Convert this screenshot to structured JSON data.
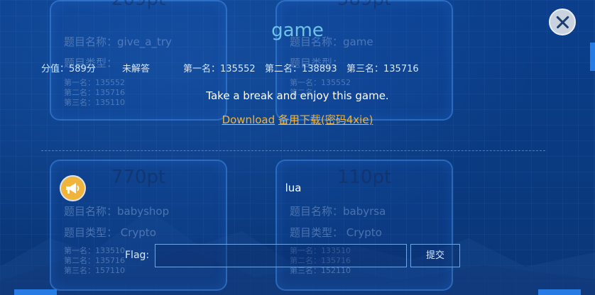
{
  "modal": {
    "title": "game",
    "score": "分值：589分",
    "status": "未解答",
    "rank1": "第一名：135552",
    "rank2": "第二名：138893",
    "rank3": "第三名：135716",
    "description": "Take a break and enjoy this game.",
    "download_label": "Download",
    "backup_label": "备用下载(密码4xie)",
    "hint_text": "lua",
    "flag_label": "Flag:",
    "flag_placeholder": "",
    "submit_label": "提交"
  },
  "background_cards": [
    {
      "points": "209pt",
      "name": "题目名称：give_a_try",
      "type": "题目类型：",
      "r1": "第一名：135552",
      "r2": "第二名：135716",
      "r3": "第三名：135110"
    },
    {
      "points": "589pt",
      "name": "题目名称：game",
      "type": "题目类型：",
      "r1": "第一名：135552",
      "r2": "第二名：",
      "r3": ""
    },
    {
      "points": "770pt",
      "name": "题目名称：babyshop",
      "type": "题目类型：  Crypto",
      "r1": "第一名：133510",
      "r2": "第二名：135716",
      "r3": "第三名：157110"
    },
    {
      "points": "110pt",
      "name": "题目名称：babyrsa",
      "type": "题目类型：  Crypto",
      "r1": "第一名：133510",
      "r2": "第二名：135716",
      "r3": "第三名：152110"
    }
  ],
  "colors": {
    "background": "#0a3d86",
    "title": "#6fc3e4",
    "link": "#f0b43a",
    "accent": "#2d8cff"
  },
  "icons": [
    "close-icon",
    "megaphone-icon"
  ]
}
